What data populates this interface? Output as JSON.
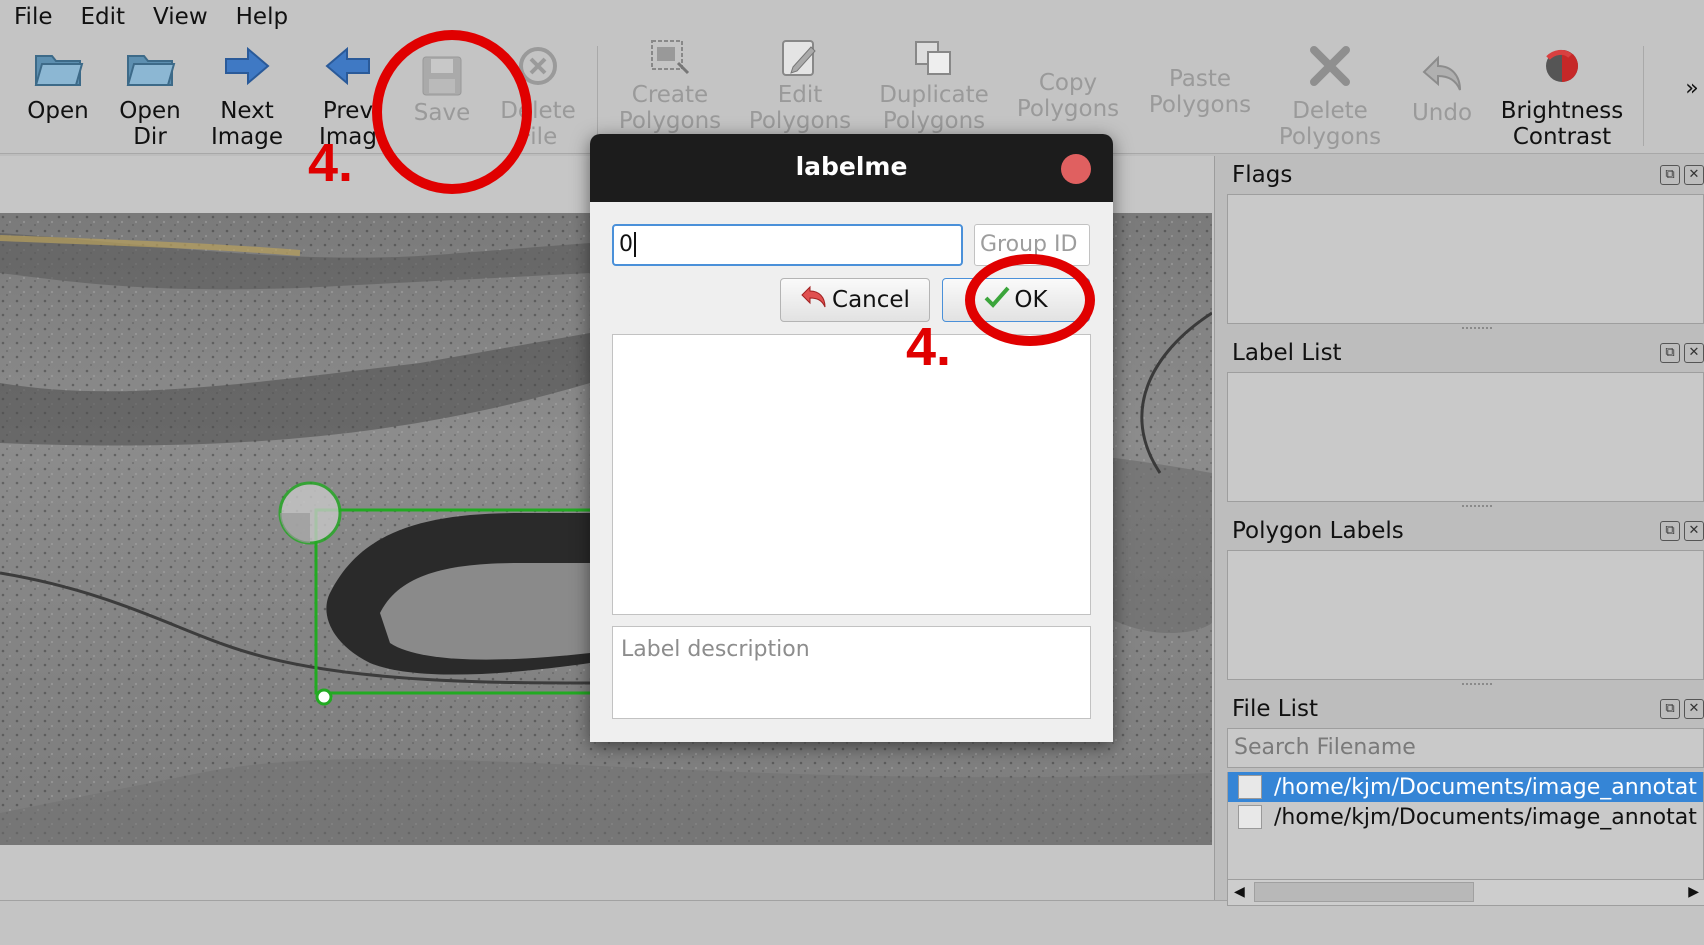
{
  "menu": [
    "File",
    "Edit",
    "View",
    "Help"
  ],
  "toolbar": {
    "open": "Open",
    "open_dir": "Open\nDir",
    "next_image": "Next\nImage",
    "prev_image": "Prev\nImag",
    "save": "Save",
    "delete_file": "Delete\nFile",
    "create_polygons": "Create\nPolygons",
    "edit_polygons": "Edit\nPolygons",
    "duplicate_polygons": "Duplicate\nPolygons",
    "copy_polygons": "Copy\nPolygons",
    "paste_polygons": "Paste\nPolygons",
    "delete_polygons": "Delete\nPolygons",
    "undo": "Undo",
    "brightness_contrast": "Brightness\nContrast",
    "overflow": "»"
  },
  "docks": {
    "flags": "Flags",
    "label_list": "Label List",
    "polygon_labels": "Polygon Labels",
    "file_list": "File List",
    "search_placeholder": "Search Filename",
    "files": [
      {
        "path": "/home/kjm/Documents/image_annotat",
        "selected": true,
        "checked": false
      },
      {
        "path": "/home/kjm/Documents/image_annotat",
        "selected": false,
        "checked": false
      }
    ]
  },
  "dialog": {
    "title": "labelme",
    "label_value": "0",
    "group_id_placeholder": "Group ID",
    "cancel": "Cancel",
    "ok": "OK",
    "description_placeholder": "Label description"
  },
  "annotations": {
    "step_save": "4.",
    "step_ok": "4.",
    "color": "#e00000"
  },
  "colors": {
    "selection": "#3585d6",
    "bbox": "#22aa22",
    "focus": "#4a90d9"
  }
}
